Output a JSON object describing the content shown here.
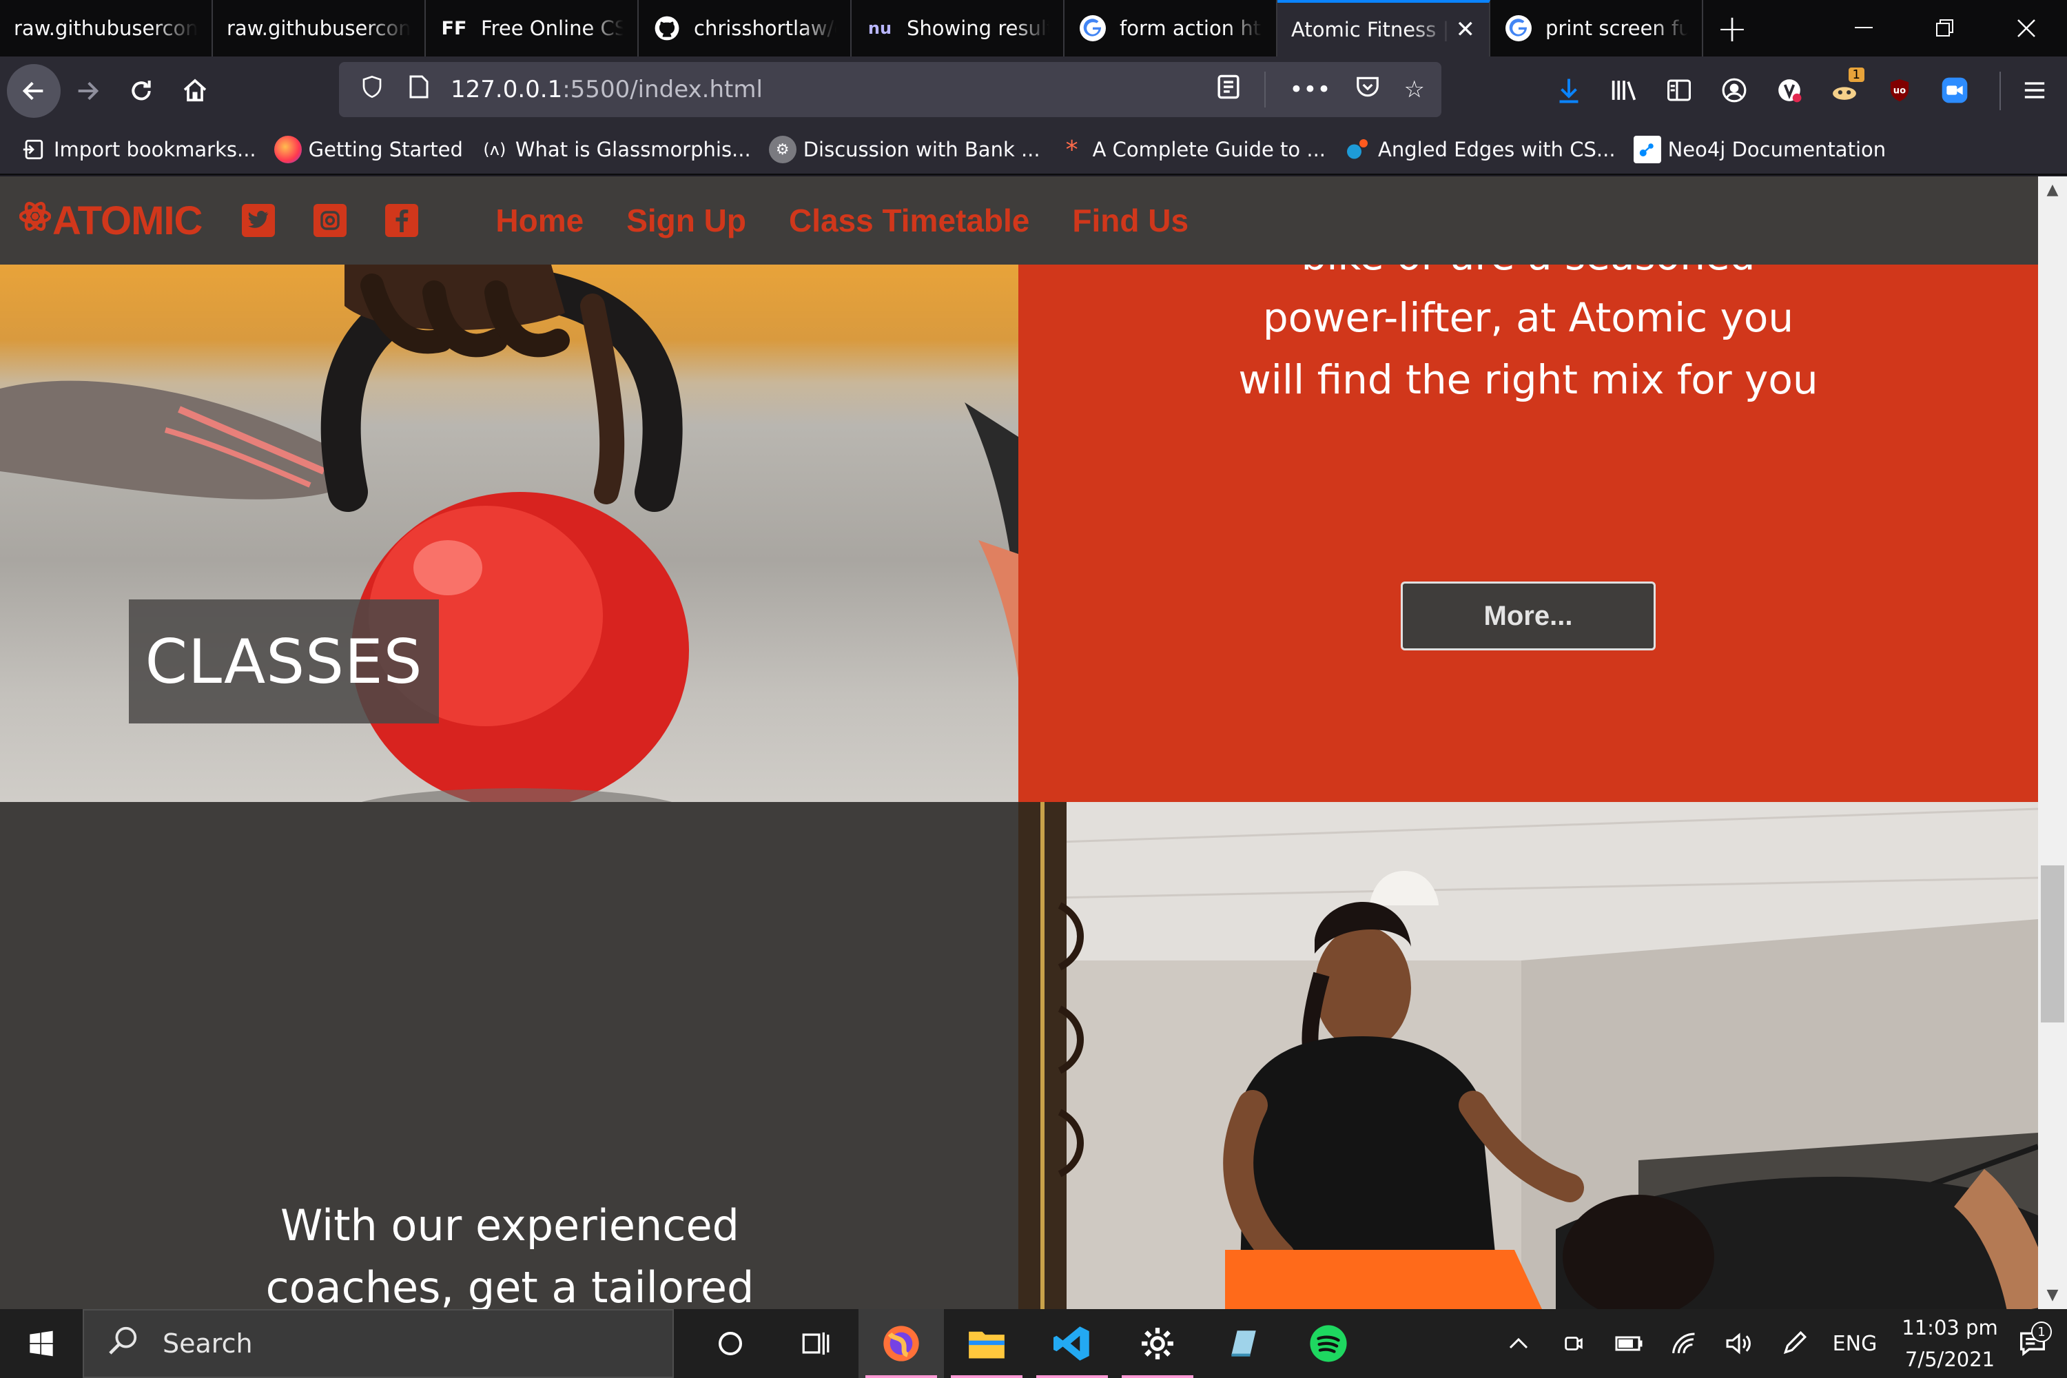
{
  "browser": {
    "tabs": [
      {
        "title": "raw.githubusercont",
        "icon": "blank-icon"
      },
      {
        "title": "raw.githubusercont",
        "icon": "blank-icon"
      },
      {
        "title": "Free Online CSS",
        "icon": "ff-icon",
        "icon_text": "FF"
      },
      {
        "title": "chrisshortlaw/c",
        "icon": "github-icon"
      },
      {
        "title": "Showing results",
        "icon": "nu-icon",
        "icon_text": "nu"
      },
      {
        "title": "form action htm",
        "icon": "google-icon"
      },
      {
        "title": "Atomic Fitness |",
        "icon": "none",
        "active": true
      },
      {
        "title": "print screen fun",
        "icon": "google-icon"
      }
    ],
    "url": {
      "host": "127.0.0.1",
      "path": ":5500/index.html"
    },
    "bookmarks": [
      {
        "label": "Import bookmarks...",
        "icon": "import-icon"
      },
      {
        "label": "Getting Started",
        "icon": "firefox-icon"
      },
      {
        "label": "What is Glassmorphis...",
        "icon": "ax-icon"
      },
      {
        "label": "Discussion with Bank ...",
        "icon": "discussion-icon"
      },
      {
        "label": "A Complete Guide to ...",
        "icon": "asterisk-icon"
      },
      {
        "label": "Angled Edges with CS...",
        "icon": "dots-icon"
      },
      {
        "label": "Neo4j Documentation",
        "icon": "neo4j-icon"
      }
    ],
    "notification_badge": "1"
  },
  "site": {
    "logo": "ATOMIC",
    "nav": [
      "Home",
      "Sign Up",
      "Class Timetable",
      "Find Us"
    ],
    "classes_label": "CLASSES",
    "red_text": "bike or are a seasoned power-lifter, at Atomic you will find the right mix for you",
    "more_button": "More...",
    "dark_text": "With our experienced coaches, get a tailored work-out programme designed for you"
  },
  "taskbar": {
    "search_placeholder": "Search",
    "lang": "ENG",
    "time": "11:03 pm",
    "date": "7/5/2021",
    "notif_count": "1"
  },
  "colors": {
    "brand": "#d1371b",
    "dark": "#3f3d3b"
  }
}
